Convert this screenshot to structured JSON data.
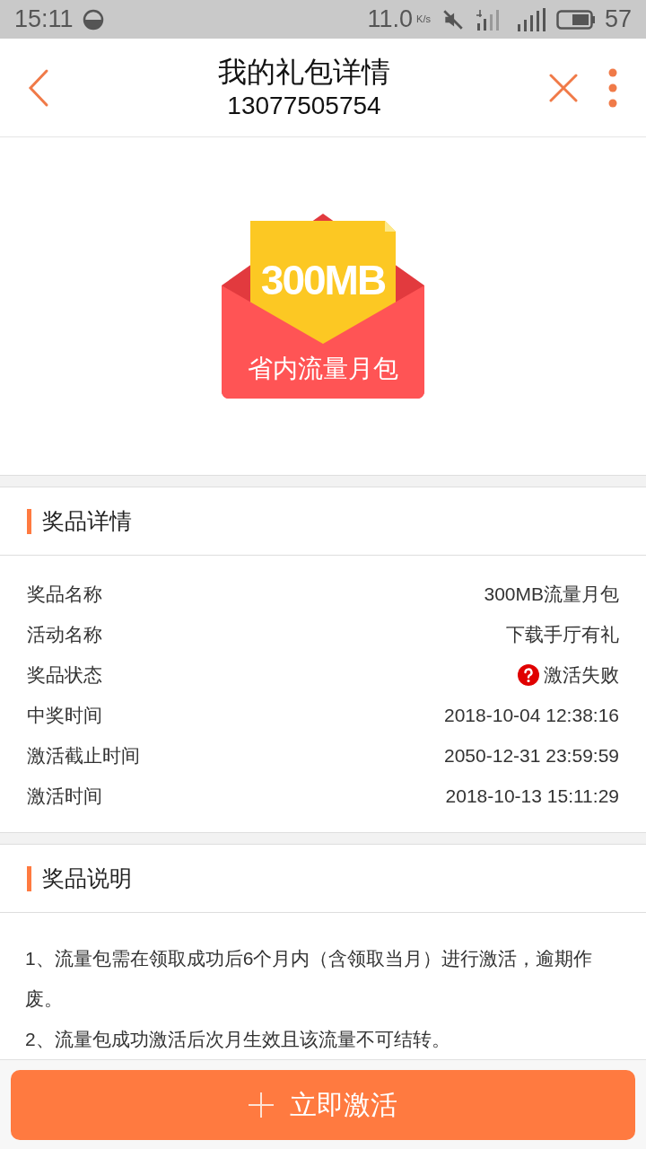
{
  "status_bar": {
    "time": "15:11",
    "speed": "11.0",
    "speed_unit": "K/s",
    "battery": "57"
  },
  "header": {
    "title": "我的礼包详情",
    "subtitle": "13077505754"
  },
  "gift": {
    "amount": "300MB",
    "name": "省内流量月包"
  },
  "details": {
    "title": "奖品详情",
    "rows": [
      {
        "kind": "plain",
        "label": "奖品名称",
        "value": "300MB流量月包"
      },
      {
        "kind": "plain",
        "label": "活动名称",
        "value": "下载手厅有礼"
      },
      {
        "kind": "error",
        "label": "奖品状态",
        "value": "激活失败"
      },
      {
        "kind": "plain",
        "label": "中奖时间",
        "value": "2018-10-04 12:38:16"
      },
      {
        "kind": "plain",
        "label": "激活截止时间",
        "value": "2050-12-31 23:59:59"
      },
      {
        "kind": "plain",
        "label": "激活时间",
        "value": "2018-10-13 15:11:29"
      }
    ]
  },
  "notes": {
    "title": "奖品说明",
    "items": [
      "1、流量包需在领取成功后6个月内（含领取当月）进行激活，逾期作废。",
      "2、流量包成功激活后次月生效且该流量不可结转。"
    ]
  },
  "action": {
    "label": "立即激活"
  }
}
